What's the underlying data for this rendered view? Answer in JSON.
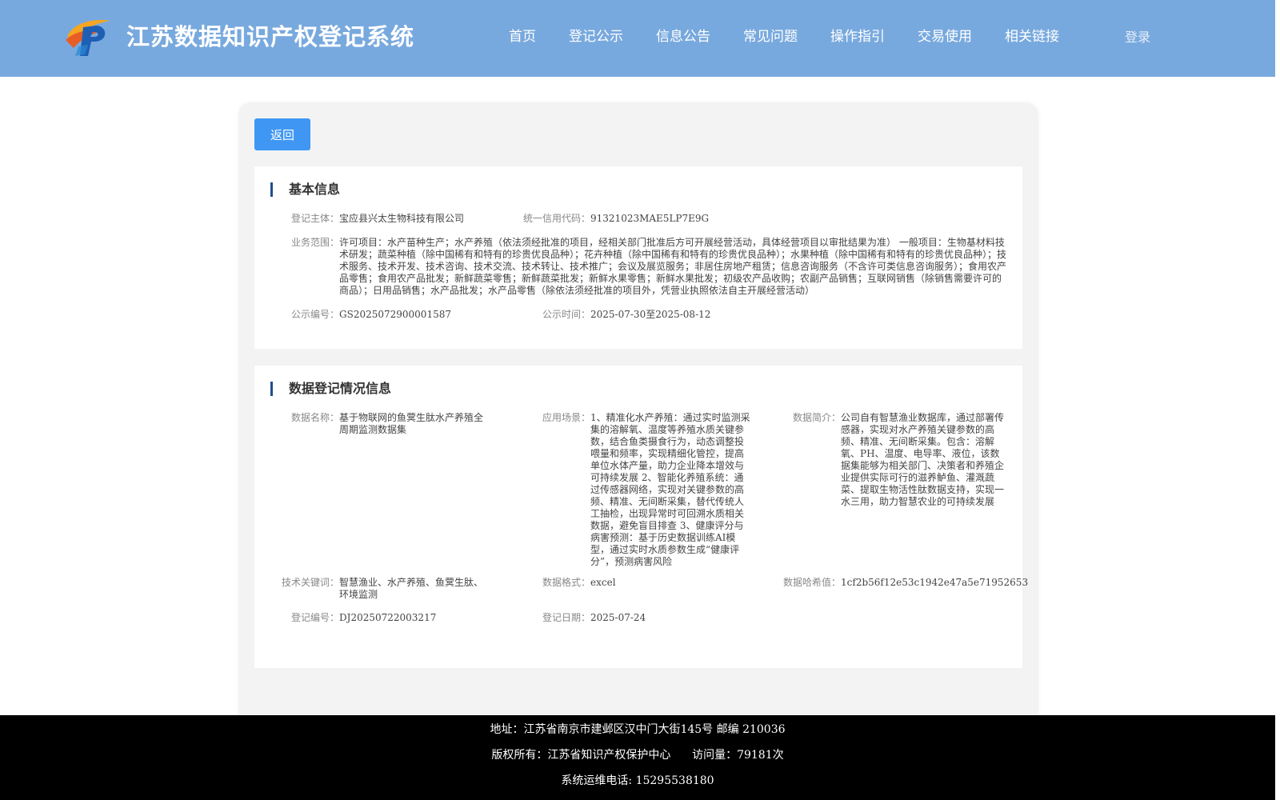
{
  "header": {
    "title": "江苏数据知识产权登记系统",
    "nav": [
      "首页",
      "登记公示",
      "信息公告",
      "常见问题",
      "操作指引",
      "交易使用",
      "相关链接"
    ],
    "login": "登录"
  },
  "main": {
    "back_label": "返回",
    "basic": {
      "title": "基本信息",
      "entity_label": "登记主体：",
      "entity_value": "宝应县兴太生物科技有限公司",
      "credit_label": "统一信用代码：",
      "credit_value": "91321023MAE5LP7E9G",
      "scope_label": "业务范围：",
      "scope_value": "许可项目：水产苗种生产；水产养殖（依法须经批准的项目，经相关部门批准后方可开展经营活动，具体经营项目以审批结果为准） 一般项目：生物基材料技术研发；蔬菜种植（除中国稀有和特有的珍贵优良品种）；花卉种植（除中国稀有和特有的珍贵优良品种）；水果种植（除中国稀有和特有的珍贵优良品种）；技术服务、技术开发、技术咨询、技术交流、技术转让、技术推广；会议及展览服务；非居住房地产租赁；信息咨询服务（不含许可类信息咨询服务）；食用农产品零售；食用农产品批发；新鲜蔬菜零售；新鲜蔬菜批发；新鲜水果零售；新鲜水果批发；初级农产品收购；农副产品销售；互联网销售（除销售需要许可的商品）；日用品销售；水产品批发；水产品零售（除依法须经批准的项目外，凭营业执照依法自主开展经营活动）",
      "pub_no_label": "公示编号：",
      "pub_no_value": "GS2025072900001587",
      "pub_time_label": "公示时间：",
      "pub_time_value": "2025-07-30至2025-08-12"
    },
    "data": {
      "title": "数据登记情况信息",
      "name_label": "数据名称：",
      "name_value": "基于物联网的鱼蓂生肽水产养殖全周期监测数据集",
      "scene_label": "应用场景：",
      "scene_value": "1、精准化水产养殖：通过实时监测采集的溶解氧、温度等养殖水质关键参数，结合鱼类摄食行为，动态调整投喂量和频率，实现精细化管控，提高单位水体产量，助力企业降本增效与可持续发展 2、智能化养殖系统：通过传感器网络，实现对关键参数的高频、精准、无间断采集，替代传统人工抽检，出现异常时可回溯水质相关数据，避免盲目排查 3、健康评分与病害预测：基于历史数据训练AI模型，通过实时水质参数生成“健康评分”，预测病害风险",
      "intro_label": "数据简介：",
      "intro_value": "公司自有智慧渔业数据库，通过部署传感器，实现对水产养殖关键参数的高频、精准、无间断采集。包含：溶解氧、PH、温度、电导率、液位，该数据集能够为相关部门、决策者和养殖企业提供实际可行的滋养鲈鱼、灌溉蔬菜、提取生物活性肽数据支持，实现一水三用，助力智慧农业的可持续发展",
      "keywords_label": "技术关键词：",
      "keywords_value": "智慧渔业、水产养殖、鱼蓂生肽、环境监测",
      "format_label": "数据格式：",
      "format_value": "excel",
      "hash_label": "数据哈希值：",
      "hash_value": "1cf2b56f12e53c1942e47a5e71952653",
      "reg_no_label": "登记编号：",
      "reg_no_value": "DJ20250722003217",
      "reg_date_label": "登记日期：",
      "reg_date_value": "2025-07-24"
    }
  },
  "footer": {
    "address": "地址：江苏省南京市建邺区汉中门大街145号 邮编 210036",
    "copyright": "版权所有：江苏省知识产权保护中心      访问量：79181次",
    "phone": "系统运维电话: 15295538180"
  }
}
